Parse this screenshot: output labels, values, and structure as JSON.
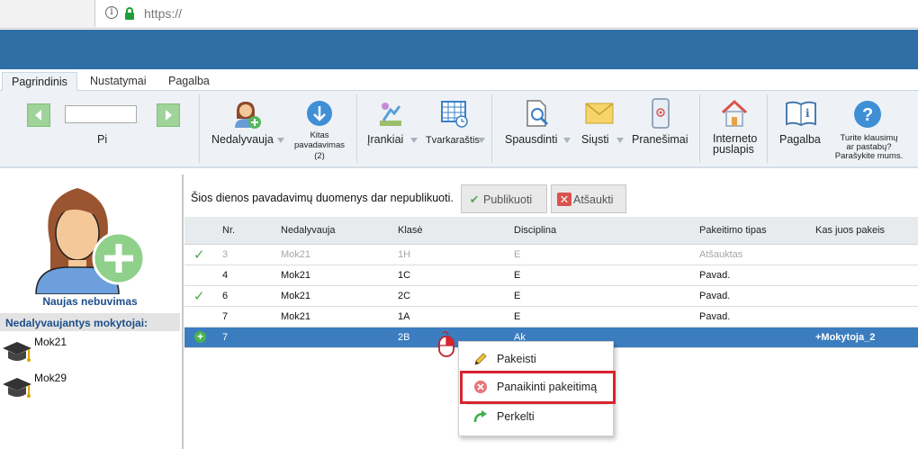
{
  "browser": {
    "url": "https://"
  },
  "tabs": [
    {
      "label": "Pagrindinis"
    },
    {
      "label": "Nustatymai"
    },
    {
      "label": "Pagalba"
    }
  ],
  "ribbon": {
    "date_label": "Pi",
    "date_value": "",
    "nedalyvauja": "Nedalyvauja",
    "kitas_line1": "Kitas",
    "kitas_line2": "pavadavimas",
    "kitas_count": "(2)",
    "irankiai": "Įrankiai",
    "tvarkarastis": "Tvarkaraštis",
    "spausdinti": "Spausdinti",
    "siusti": "Siųsti",
    "pranesimai": "Pranešimai",
    "interneto_line1": "Interneto",
    "interneto_line2": "puslapis",
    "pagalba": "Pagalba",
    "help_line1": "Turite klausimų",
    "help_line2": "ar pastabų?",
    "help_line3": "Parašykite mums."
  },
  "left": {
    "new_absence": "Naujas nebuvimas",
    "absent_header": "Nedalyvaujantys mokytojai:",
    "teachers": [
      {
        "name": "Mok21"
      },
      {
        "name": "Mok29"
      }
    ]
  },
  "main": {
    "notice": "Šios dienos pavadavimų duomenys dar nepublikuoti.",
    "publish_label": "Publikuoti",
    "cancel_label": "Atšaukti",
    "columns": {
      "nr": "Nr.",
      "nedalyvauja": "Nedalyvauja",
      "klase": "Klasė",
      "disciplina": "Disciplina",
      "tipas": "Pakeitimo tipas",
      "kas": "Kas juos pakeis"
    },
    "rows": [
      {
        "nr": "3",
        "teacher": "Mok21",
        "class": "1H",
        "discipline": "E",
        "type": "Atšauktas",
        "who": ""
      },
      {
        "nr": "4",
        "teacher": "Mok21",
        "class": "1C",
        "discipline": "E",
        "type": "Pavad.",
        "who": ""
      },
      {
        "nr": "6",
        "teacher": "Mok21",
        "class": "2C",
        "discipline": "E",
        "type": "Pavad.",
        "who": ""
      },
      {
        "nr": "7",
        "teacher": "Mok21",
        "class": "1A",
        "discipline": "E",
        "type": "Pavad.",
        "who": ""
      },
      {
        "nr": "7",
        "teacher": "",
        "class": "2B",
        "discipline": "Ak",
        "type": "",
        "who": "+Mokytoja_2"
      }
    ]
  },
  "context_menu": {
    "edit": "Pakeisti",
    "remove": "Panaikinti pakeitimą",
    "move": "Perkelti"
  },
  "colors": {
    "banner": "#2f6fa6",
    "selected_row": "#3b7dbf",
    "highlight": "#d9232f",
    "check": "#4ea74a"
  }
}
